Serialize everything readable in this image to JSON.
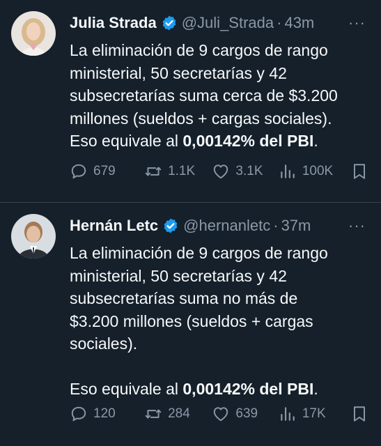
{
  "colors": {
    "background": "#15202b",
    "text": "#f7f9f9",
    "muted": "#8b98a5",
    "verified": "#1d9bf0",
    "divider": "#38444d"
  },
  "tweets": [
    {
      "name": "Julia Strada",
      "handle": "@Juli_Strada",
      "dot": "·",
      "time": "43m",
      "more": "···",
      "lines": [
        "La eliminación de 9 cargos de rango",
        "ministerial, 50 secretarías y 42",
        "subsecretarías suma cerca de $3.200",
        "millones (sueldos + cargas sociales)."
      ],
      "last_prefix": "Eso equivale al ",
      "last_bold": "0,00142% del PBI",
      "last_suffix": ".",
      "replies": "679",
      "retweets": "1.1K",
      "likes": "3.1K",
      "views": "100K",
      "icons": [
        "reply-icon",
        "retweet-icon",
        "like-icon",
        "views-icon",
        "bookmark-icon"
      ]
    },
    {
      "name": "Hernán Letc",
      "handle": "@hernanletc",
      "dot": "·",
      "time": "37m",
      "more": "···",
      "lines": [
        "La eliminación de 9 cargos de rango",
        "ministerial, 50 secretarías y 42",
        "subsecretarías suma no más de",
        "$3.200 millones (sueldos + cargas",
        "sociales)."
      ],
      "last_prefix": "Eso equivale al ",
      "last_bold": "0,00142% del PBI",
      "last_suffix": ".",
      "replies": "120",
      "retweets": "284",
      "likes": "639",
      "views": "17K",
      "icons": [
        "reply-icon",
        "retweet-icon",
        "like-icon",
        "views-icon",
        "bookmark-icon"
      ]
    }
  ]
}
